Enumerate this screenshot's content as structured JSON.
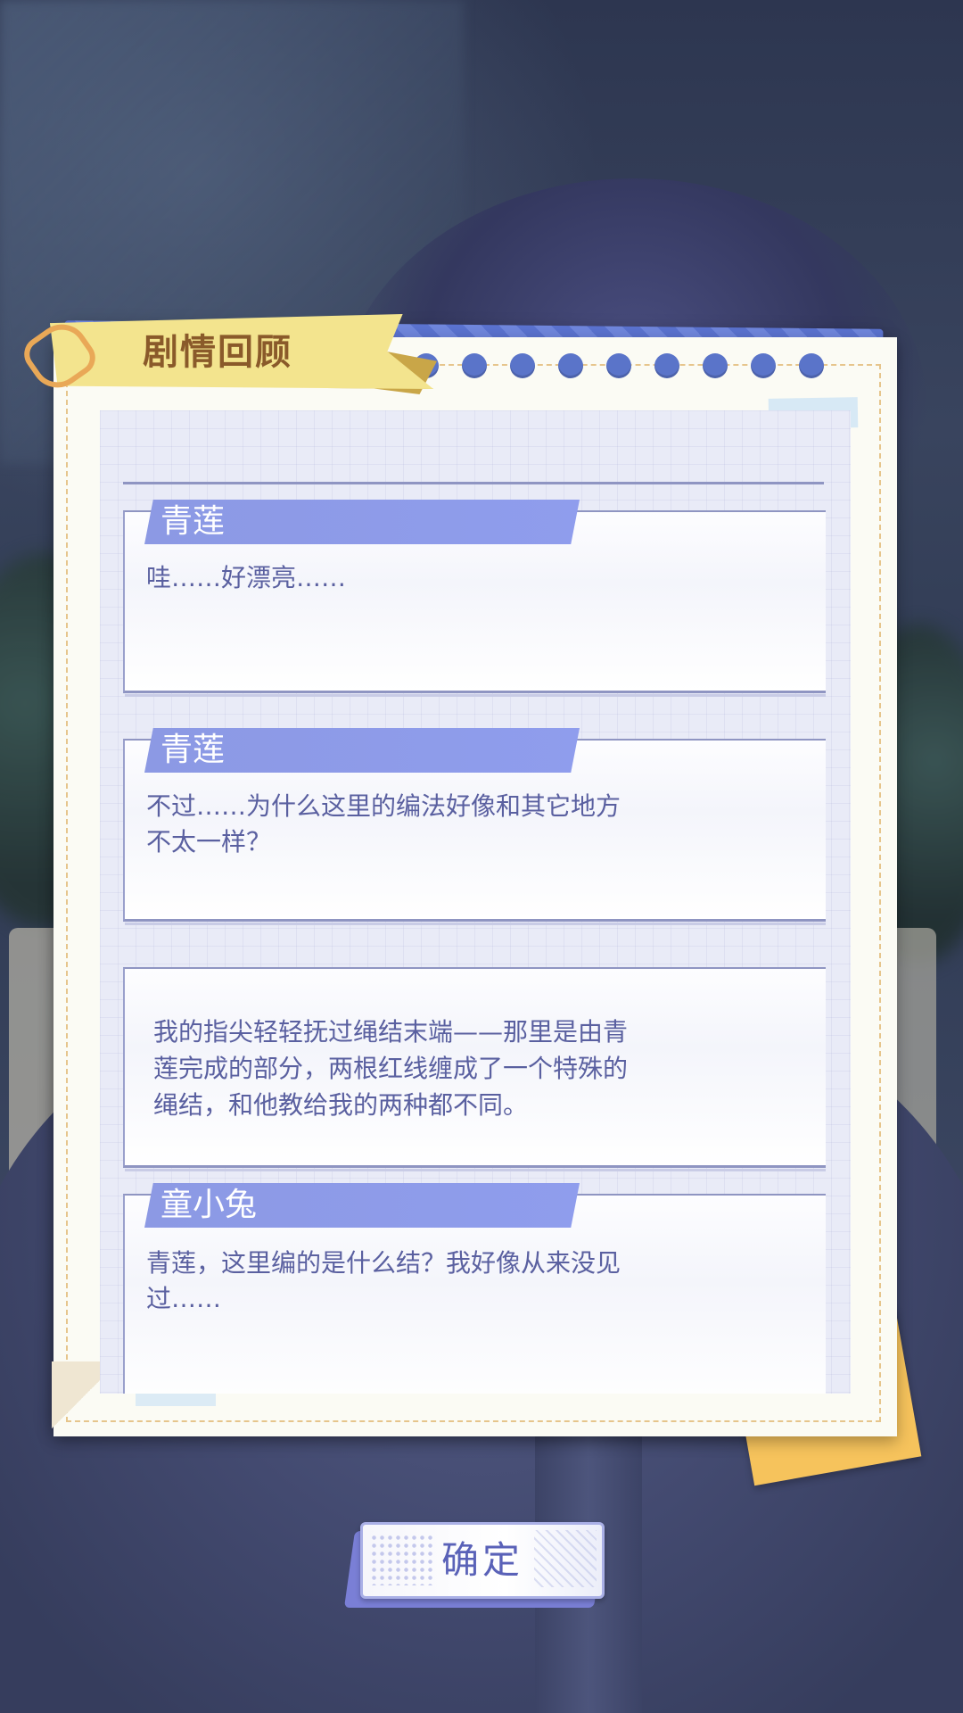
{
  "panel": {
    "title": "剧情回顾"
  },
  "log": [
    {
      "speaker": "青莲",
      "text": "哇……好漂亮……"
    },
    {
      "speaker": "青莲",
      "text": "不过……为什么这里的编法好像和其它地方\n不太一样？"
    },
    {
      "speaker": "",
      "text": "我的指尖轻轻抚过绳结末端——那里是由青\n莲完成的部分，两根红线缠成了一个特殊的\n绳结，和他教给我的两种都不同。"
    },
    {
      "speaker": "童小兔",
      "text": "青莲，这里编的是什么结？我好像从来没见\n过……"
    }
  ],
  "confirm_button": {
    "label": "确定"
  },
  "colors": {
    "name_tag": "#8c99e4",
    "text": "#5a60a0",
    "banner": "#f3e48e",
    "dots": "#5a74c9"
  }
}
